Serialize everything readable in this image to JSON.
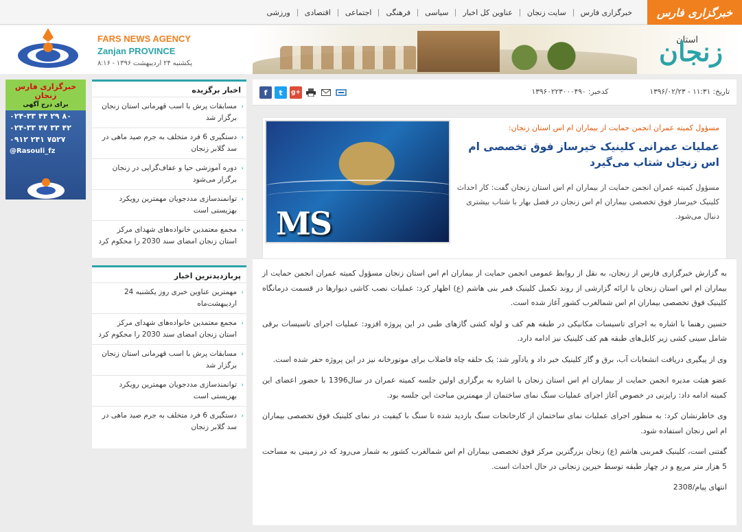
{
  "nav": {
    "logo": "خبرگزاری فارس",
    "items": [
      "خبرگزاری فارس",
      "سایت زنجان",
      "عناوین کل اخبار",
      "سیاسی",
      "فرهنگی",
      "اجتماعی",
      "اقتصادی",
      "ورزشی"
    ]
  },
  "header": {
    "ostan": "استان",
    "zanjan": "زنجان",
    "agency_en": "FARS NEWS AGENCY",
    "province_en": "Zanjan PROVINCE",
    "date": "یکشنبه ۲۴ اردیبهشت ۱۳۹۶ - ۸:۱۶"
  },
  "ad": {
    "title": "خبرگزاری فارس زنجان",
    "subtitle": "برای درج آگهی",
    "phones": [
      "۰۲۴-۳۳ ۴۴ ۲۹ ۸۰",
      "۰۲۴-۳۳ ۴۷ ۳۳ ۴۲",
      "۰۹۱۲ ۲۴۱ ۷۵۲۷"
    ],
    "handle": "@Rasouli_fz"
  },
  "featured": {
    "title": "اخبار برگزیده",
    "items": [
      "مسابقات پرش با اسب قهرمانی استان زنجان برگزار شد",
      "دستگیری 6 فرد متخلف به جرم صید ماهی در سد گلابر زنجان",
      "دوره آموزشی حیا و عفاف‌گرایی در زنجان برگزار می‌شود",
      "توانمندسازی مددجویان مهمترین رویکرد بهزیستی است",
      "مجمع معتمدین خانواده‌های شهدای مرکز استان زنجان امضای سند 2030 را محکوم کرد"
    ]
  },
  "most_viewed": {
    "title": "پربازدیدترین اخبار",
    "items": [
      "مهمترین عناوین خبری روز یکشنبه 24 اردیبهشت‌ماه",
      "مجمع معتمدین خانواده‌های شهدای مرکز استان زنجان امضای سند 2030 را محکوم کرد",
      "مسابقات پرش با اسب قهرمانی استان زنجان برگزار شد",
      "توانمندسازی مددجویان مهمترین رویکرد بهزیستی است",
      "دستگیری 6 فرد متخلف به جرم صید ماهی در سد گلابر زنجان"
    ]
  },
  "toolbar": {
    "date": "تاریخ: ۱۱:۳۱ - ۱۳۹۶/۰۲/۲۳",
    "code": "کدخبر: ۱۳۹۶۰۲۲۳۰۰۰۴۹۰",
    "icons": [
      "facebook-icon",
      "twitter-icon",
      "google-plus-icon",
      "print-icon",
      "email-icon",
      "link-icon"
    ]
  },
  "article": {
    "image_text": "MS",
    "kicker": "مسؤول کمیته عمران انجمن حمایت از بیماران ام اس استان زنجان:",
    "headline": "عملیات عمرانی کلینیک خیرساز فوق تخصصی ام اس زنجان شتاب می‌گیرد",
    "summary": "مسؤول کمیته عمران انجمن حمایت از بیماران ام اس استان زنجان گفت: کار احداث کلینیک خیرساز فوق تخصصی بیماران ام اس زنجان در فصل بهار با شتاب بیشتری دنبال می‌شود.",
    "paragraphs": [
      "به گزارش خبرگزاری فارس از زنجان، به نقل از روابط عمومی انجمن حمایت از بیماران ام اس استان زنجان مسؤول کمیته عمران انجمن حمایت از بیماران ام اس استان زنجان با ارائه گزارشی از روند تکمیل کلینیک قمر بنی هاشم (ع) اظهار کرد: عملیات نصب کاشی دیوارها در قسمت درمانگاه کلینیک فوق تخصصی بیماران ام اس شمالغرب کشور آغاز شده است.",
      "حسین رهنما با اشاره به اجرای تاسیسات مکانیکی در طبقه هم کف و لوله کشی گازهای طبی در این پروژه افزود: عملیات اجرای تاسیسات برقی شامل سینی کشی زیر کابل‌های طبقه هم کف کلینیک نیز ادامه دارد.",
      "وی از پیگیری دریافت انشعابات آب، برق و گاز کلینیک خبر داد و یادآور شد: یک حلقه چاه فاضلاب برای موتورخانه نیز در این پروژه حفر شده است.",
      "عضو هیئت مدیره انجمن حمایت از بیماران ام اس استان زنجان با اشاره به برگزاری اولین جلسه کمیته عمران در سال1396 با حضور اعضای این کمیته ادامه داد: رایزنی در خصوص آغاز اجرای عملیات سنگ نمای ساختمان از مهمترین مباحث این جلسه بود.",
      "وی خاطرنشان کرد: به منظور اجرای عملیات نمای ساختمان از کارخانجات سنگ بازدید شده تا سنگ با کیفیت در نمای کلینیک فوق تخصصی بیماران ام اس زنجان استفاده شود.",
      "گفتنی است، کلینیک قمربنی هاشم (ع) زنجان بزرگترین مرکز فوق تخصصی بیماران ام اس شمالغرب کشور به شمار می‌رود که در زمینی به مساحت 5 هزار متر مربع و در چهار طبقه توسط خیرین زنجانی در حال احداث است."
    ],
    "signature": "انتهای پیام/2308"
  },
  "colors": {
    "accent": "#2aa3a8",
    "brand": "#f07f1e",
    "headline": "#1c4a8f",
    "kicker": "#e05a0a"
  }
}
